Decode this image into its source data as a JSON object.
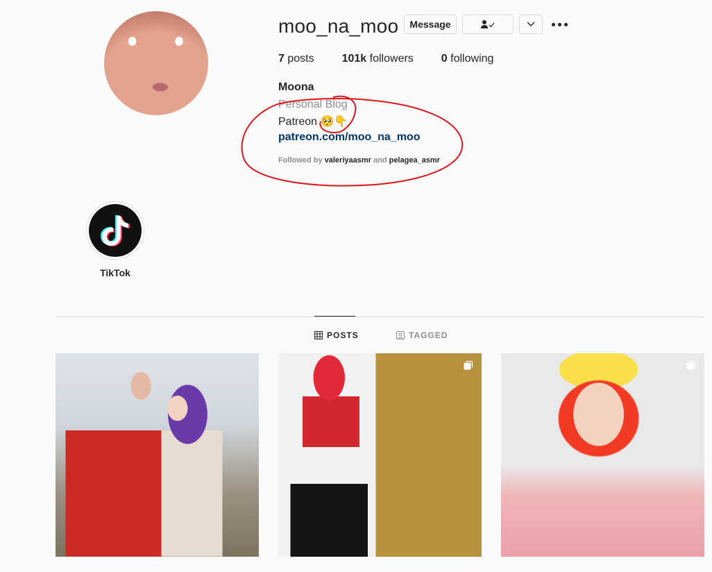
{
  "profile": {
    "username": "moo_na_moo",
    "message_label": "Message",
    "follow_icon": "person-check-icon",
    "stats": {
      "posts_count": "7",
      "posts_label": "posts",
      "followers_count": "101k",
      "followers_label": "followers",
      "following_count": "0",
      "following_label": "following"
    },
    "bio": {
      "name": "Moona",
      "category": "Personal Blog",
      "line": "Patreon 🥺👇",
      "link": "patreon.com/moo_na_moo",
      "followed_by_prefix": "Followed by",
      "followed_user_1": "valeriyaasmr",
      "followed_and": "and",
      "followed_user_2": "pelagea_asmr"
    }
  },
  "highlights": [
    {
      "label": "TikTok",
      "icon": "tiktok-icon"
    }
  ],
  "tabs": {
    "posts": "POSTS",
    "tagged": "TAGGED"
  },
  "colors": {
    "link": "#00376b",
    "annotation": "#e0131b",
    "muted": "#8e8e8e"
  }
}
